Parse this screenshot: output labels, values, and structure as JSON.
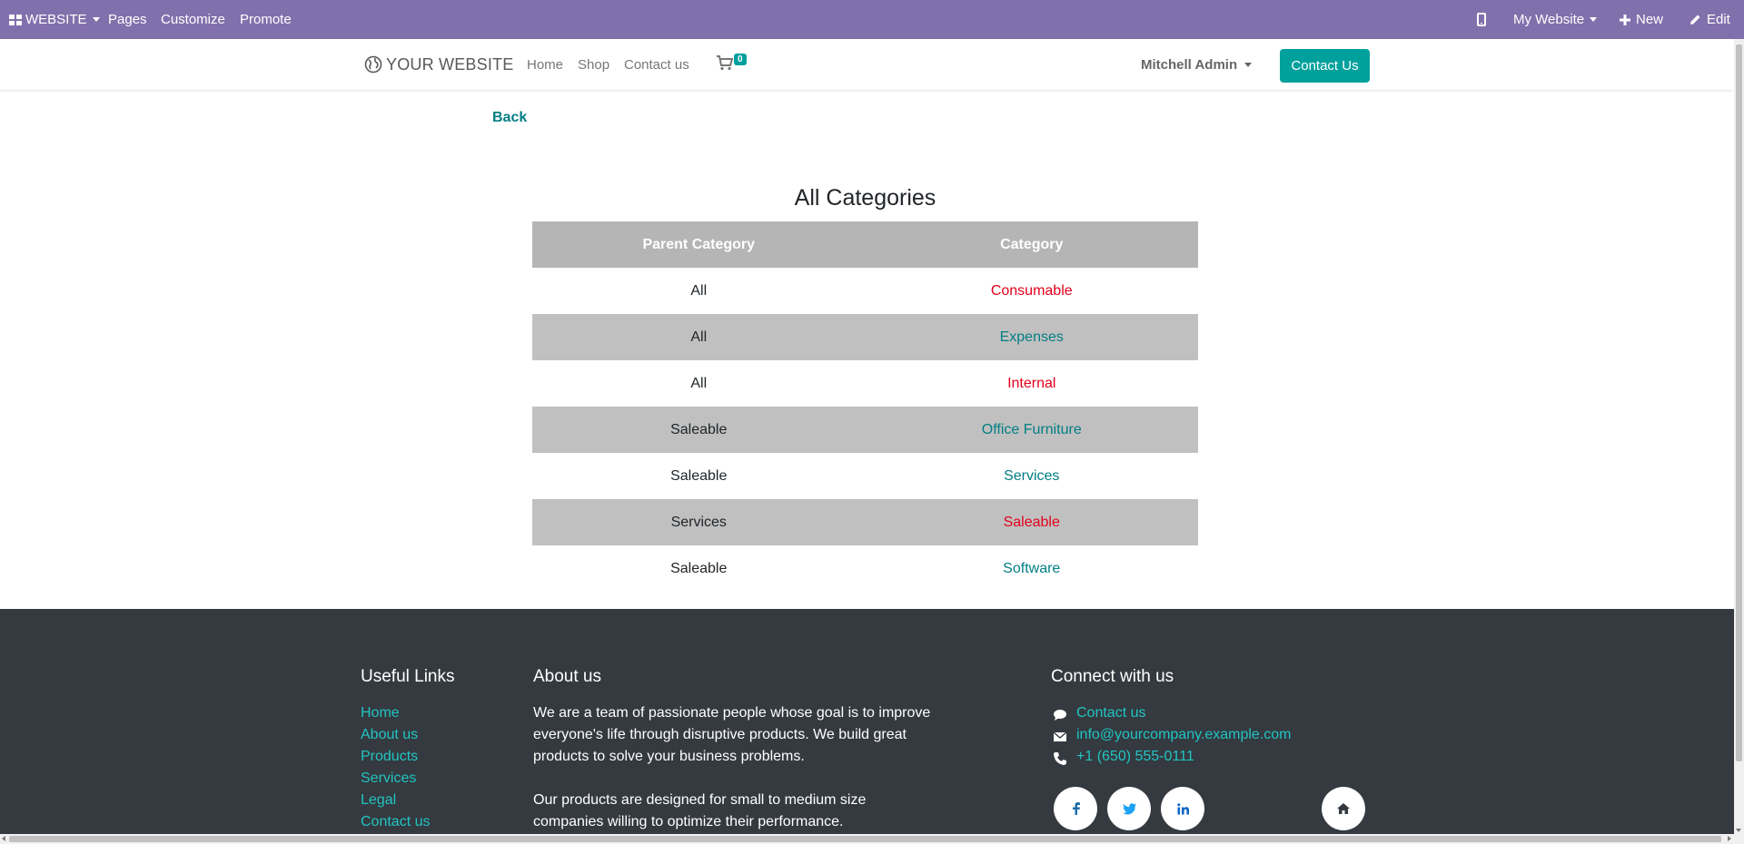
{
  "topbar": {
    "website_label": "WEBSITE",
    "pages_label": "Pages",
    "customize_label": "Customize",
    "promote_label": "Promote",
    "site_selector_label": "My Website",
    "new_label": "New",
    "edit_label": "Edit",
    "bar_color": "#8270ac"
  },
  "header": {
    "logo_text": "YOUR WEBSITE",
    "nav": [
      "Home",
      "Shop",
      "Contact us"
    ],
    "cart_count": "0",
    "user_name": "Mitchell Admin",
    "contact_button": "Contact Us",
    "accent_color": "#00a09d"
  },
  "main": {
    "back_label": "Back",
    "title": "All Categories",
    "columns": [
      "Parent Category",
      "Category"
    ],
    "rows": [
      {
        "parent": "All",
        "category": "Consumable",
        "color": "#e3001b"
      },
      {
        "parent": "All",
        "category": "Expenses",
        "color": "#017e84"
      },
      {
        "parent": "All",
        "category": "Internal",
        "color": "#e3001b"
      },
      {
        "parent": "Saleable",
        "category": "Office Furniture",
        "color": "#017e84"
      },
      {
        "parent": "Saleable",
        "category": "Services",
        "color": "#017e84"
      },
      {
        "parent": "Services",
        "category": "Saleable",
        "color": "#e3001b"
      },
      {
        "parent": "Saleable",
        "category": "Software",
        "color": "#017e84"
      }
    ]
  },
  "footer": {
    "useful_links_heading": "Useful Links",
    "useful_links": [
      "Home",
      "About us",
      "Products",
      "Services",
      "Legal",
      "Contact us"
    ],
    "about_heading": "About us",
    "about_paragraph_1": "We are a team of passionate people whose goal is to improve everyone's life through disruptive products. We build great products to solve your business problems.",
    "about_paragraph_2": "Our products are designed for small to medium size companies willing to optimize their performance.",
    "connect_heading": "Connect with us",
    "contact_link": "Contact us",
    "email": "info@yourcompany.example.com",
    "phone": "+1 (650) 555-0111",
    "social_icons": [
      "facebook-icon",
      "twitter-icon",
      "linkedin-icon",
      "home-icon"
    ]
  }
}
